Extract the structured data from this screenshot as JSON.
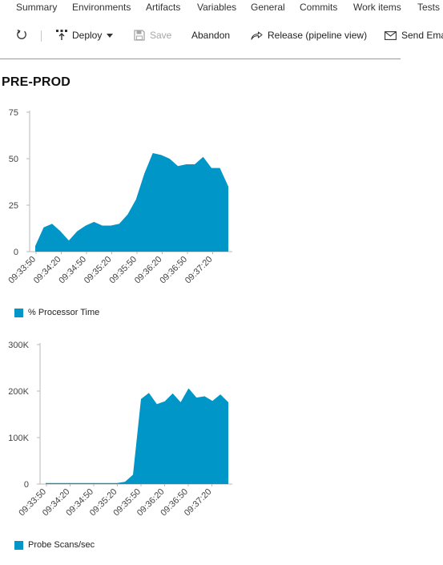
{
  "tabs": [
    "Summary",
    "Environments",
    "Artifacts",
    "Variables",
    "General",
    "Commits",
    "Work items",
    "Tests"
  ],
  "toolbar": {
    "refresh_icon": "refresh-icon",
    "deploy_label": "Deploy",
    "save_label": "Save",
    "abandon_label": "Abandon",
    "release_label": "Release (pipeline view)",
    "send_label": "Send Ema"
  },
  "stage_title": "PRE-PROD",
  "colors": {
    "series": "#0096c8",
    "axis": "#b8b8b8",
    "text": "#444444"
  },
  "chart_data": [
    {
      "type": "area",
      "x_ticks": [
        "09:33:50",
        "09:34:20",
        "09:34:50",
        "09:35:20",
        "09:35:50",
        "09:36:20",
        "09:36:50",
        "09:37:20"
      ],
      "y_ticks": [
        "0",
        "25",
        "50",
        "75"
      ],
      "ylim": [
        0,
        75
      ],
      "series": [
        {
          "name": "% Processor Time",
          "values": [
            3,
            13,
            15,
            11,
            6,
            11,
            14,
            16,
            14,
            14,
            15,
            20,
            28,
            42,
            53,
            52,
            50,
            46,
            47,
            47,
            51,
            45,
            45,
            35
          ]
        }
      ]
    },
    {
      "type": "area",
      "x_ticks": [
        "09:33:50",
        "09:34:20",
        "09:34:50",
        "09:35:20",
        "09:35:50",
        "09:36:20",
        "09:36:50",
        "09:37:20"
      ],
      "y_ticks": [
        "0",
        "100K",
        "200K",
        "300K"
      ],
      "ylim": [
        0,
        300000
      ],
      "series": [
        {
          "name": "Probe Scans/sec",
          "values": [
            2000,
            2000,
            2000,
            2000,
            2000,
            2000,
            2000,
            2000,
            2000,
            2000,
            5000,
            20000,
            183000,
            196000,
            172000,
            178000,
            195000,
            176000,
            206000,
            186000,
            189000,
            179000,
            193000,
            176000
          ]
        }
      ]
    }
  ]
}
